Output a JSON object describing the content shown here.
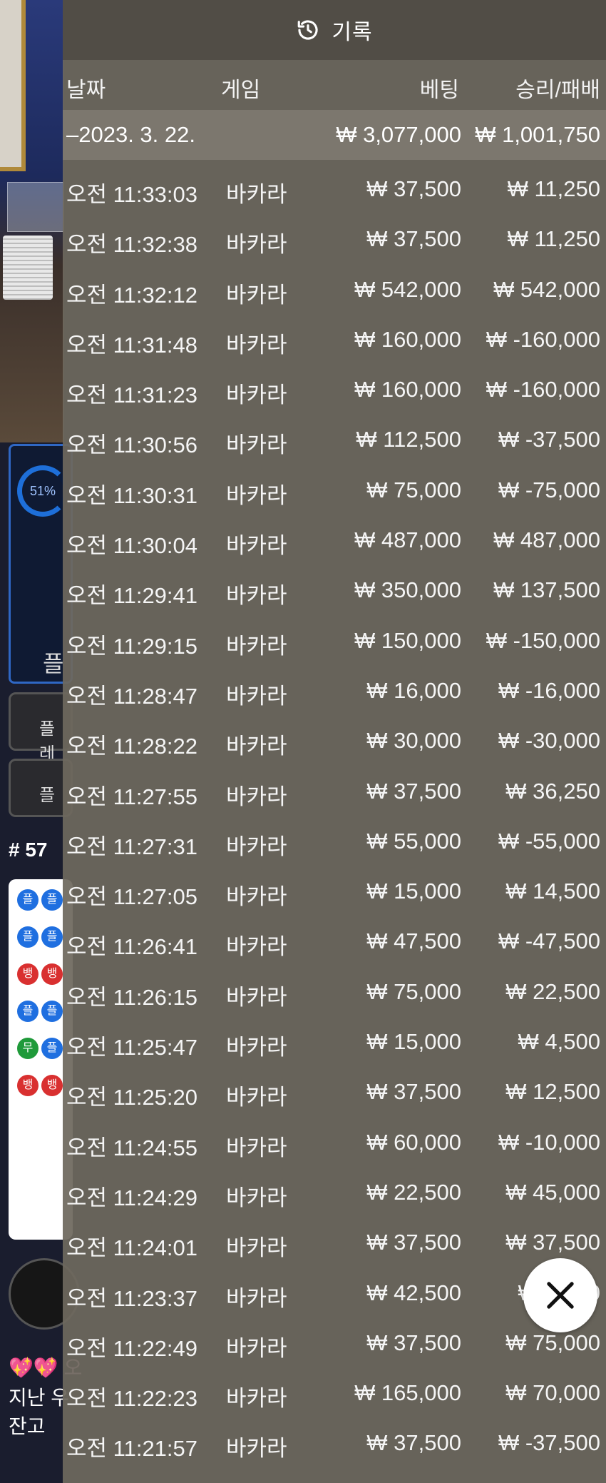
{
  "background": {
    "progress_percent": "51%",
    "player_label": "플",
    "button_1": "플레",
    "button_2": "플",
    "round_number": "# 57",
    "road_glyph_player": "플",
    "road_glyph_banker": "뱅",
    "road_glyph_tie": "무",
    "chat_line_1": "💖💖 오",
    "chat_line_2": "지난 우",
    "chat_line_3": "잔고"
  },
  "panel": {
    "title": "기록",
    "icon": "history-icon"
  },
  "columns": {
    "date": "날짜",
    "game": "게임",
    "bet": "베팅",
    "win_loss": "승리/패배"
  },
  "day_summary": {
    "date": "–2023. 3. 22.",
    "total_bet": "₩ 3,077,000",
    "total_win_loss": "₩ 1,001,750"
  },
  "transactions": [
    {
      "time": "오전 11:33:03",
      "game": "바카라",
      "bet": "₩ 37,500",
      "win_loss": "₩ 11,250"
    },
    {
      "time": "오전 11:32:38",
      "game": "바카라",
      "bet": "₩ 37,500",
      "win_loss": "₩ 11,250"
    },
    {
      "time": "오전 11:32:12",
      "game": "바카라",
      "bet": "₩ 542,000",
      "win_loss": "₩ 542,000"
    },
    {
      "time": "오전 11:31:48",
      "game": "바카라",
      "bet": "₩ 160,000",
      "win_loss": "₩ -160,000"
    },
    {
      "time": "오전 11:31:23",
      "game": "바카라",
      "bet": "₩ 160,000",
      "win_loss": "₩ -160,000"
    },
    {
      "time": "오전 11:30:56",
      "game": "바카라",
      "bet": "₩ 112,500",
      "win_loss": "₩ -37,500"
    },
    {
      "time": "오전 11:30:31",
      "game": "바카라",
      "bet": "₩ 75,000",
      "win_loss": "₩ -75,000"
    },
    {
      "time": "오전 11:30:04",
      "game": "바카라",
      "bet": "₩ 487,000",
      "win_loss": "₩ 487,000"
    },
    {
      "time": "오전 11:29:41",
      "game": "바카라",
      "bet": "₩ 350,000",
      "win_loss": "₩ 137,500"
    },
    {
      "time": "오전 11:29:15",
      "game": "바카라",
      "bet": "₩ 150,000",
      "win_loss": "₩ -150,000"
    },
    {
      "time": "오전 11:28:47",
      "game": "바카라",
      "bet": "₩ 16,000",
      "win_loss": "₩ -16,000"
    },
    {
      "time": "오전 11:28:22",
      "game": "바카라",
      "bet": "₩ 30,000",
      "win_loss": "₩ -30,000"
    },
    {
      "time": "오전 11:27:55",
      "game": "바카라",
      "bet": "₩ 37,500",
      "win_loss": "₩ 36,250"
    },
    {
      "time": "오전 11:27:31",
      "game": "바카라",
      "bet": "₩ 55,000",
      "win_loss": "₩ -55,000"
    },
    {
      "time": "오전 11:27:05",
      "game": "바카라",
      "bet": "₩ 15,000",
      "win_loss": "₩ 14,500"
    },
    {
      "time": "오전 11:26:41",
      "game": "바카라",
      "bet": "₩ 47,500",
      "win_loss": "₩ -47,500"
    },
    {
      "time": "오전 11:26:15",
      "game": "바카라",
      "bet": "₩ 75,000",
      "win_loss": "₩ 22,500"
    },
    {
      "time": "오전 11:25:47",
      "game": "바카라",
      "bet": "₩ 15,000",
      "win_loss": "₩ 4,500"
    },
    {
      "time": "오전 11:25:20",
      "game": "바카라",
      "bet": "₩ 37,500",
      "win_loss": "₩ 12,500"
    },
    {
      "time": "오전 11:24:55",
      "game": "바카라",
      "bet": "₩ 60,000",
      "win_loss": "₩ -10,000"
    },
    {
      "time": "오전 11:24:29",
      "game": "바카라",
      "bet": "₩ 22,500",
      "win_loss": "₩ 45,000"
    },
    {
      "time": "오전 11:24:01",
      "game": "바카라",
      "bet": "₩ 37,500",
      "win_loss": "₩ 37,500"
    },
    {
      "time": "오전 11:23:37",
      "game": "바카라",
      "bet": "₩ 42,500",
      "win_loss": "₩ 5,000"
    },
    {
      "time": "오전 11:22:49",
      "game": "바카라",
      "bet": "₩ 37,500",
      "win_loss": "₩ 75,000"
    },
    {
      "time": "오전 11:22:23",
      "game": "바카라",
      "bet": "₩ 165,000",
      "win_loss": "₩ 70,000"
    },
    {
      "time": "오전 11:21:57",
      "game": "바카라",
      "bet": "₩ 37,500",
      "win_loss": "₩ -37,500"
    }
  ],
  "close_button": {
    "icon": "close-icon"
  },
  "colors": {
    "panel_bg": "#6e685e",
    "header_bg": "#504c46",
    "accent_blue": "#1f6fe0",
    "banker_red": "#d93030"
  }
}
